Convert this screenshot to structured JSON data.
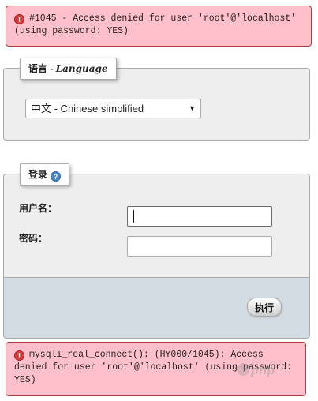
{
  "errors": {
    "top": "#1045 - Access denied for user 'root'@'localhost' (using password: YES)",
    "bottom": "mysqli_real_connect(): (HY000/1045): Access denied for user 'root'@'localhost' (using password: YES)"
  },
  "language": {
    "legend_cn": "语言 -",
    "legend_en": "Language",
    "selected": "中文 - Chinese simplified",
    "arrow": "▼"
  },
  "login": {
    "legend": "登录",
    "username_label": "用户名：",
    "password_label": "密码：",
    "username_value": "",
    "password_value": "",
    "submit": "执行"
  },
  "icons": {
    "error": "!",
    "help": "?"
  },
  "watermark": {
    "text": "php"
  },
  "colors": {
    "error_bg": "#ffc0cb",
    "error_border": "#b23c3c",
    "panel_bg": "#eeeeee",
    "footer_bg": "#d3dce3",
    "help_icon": "#4a86c8"
  }
}
